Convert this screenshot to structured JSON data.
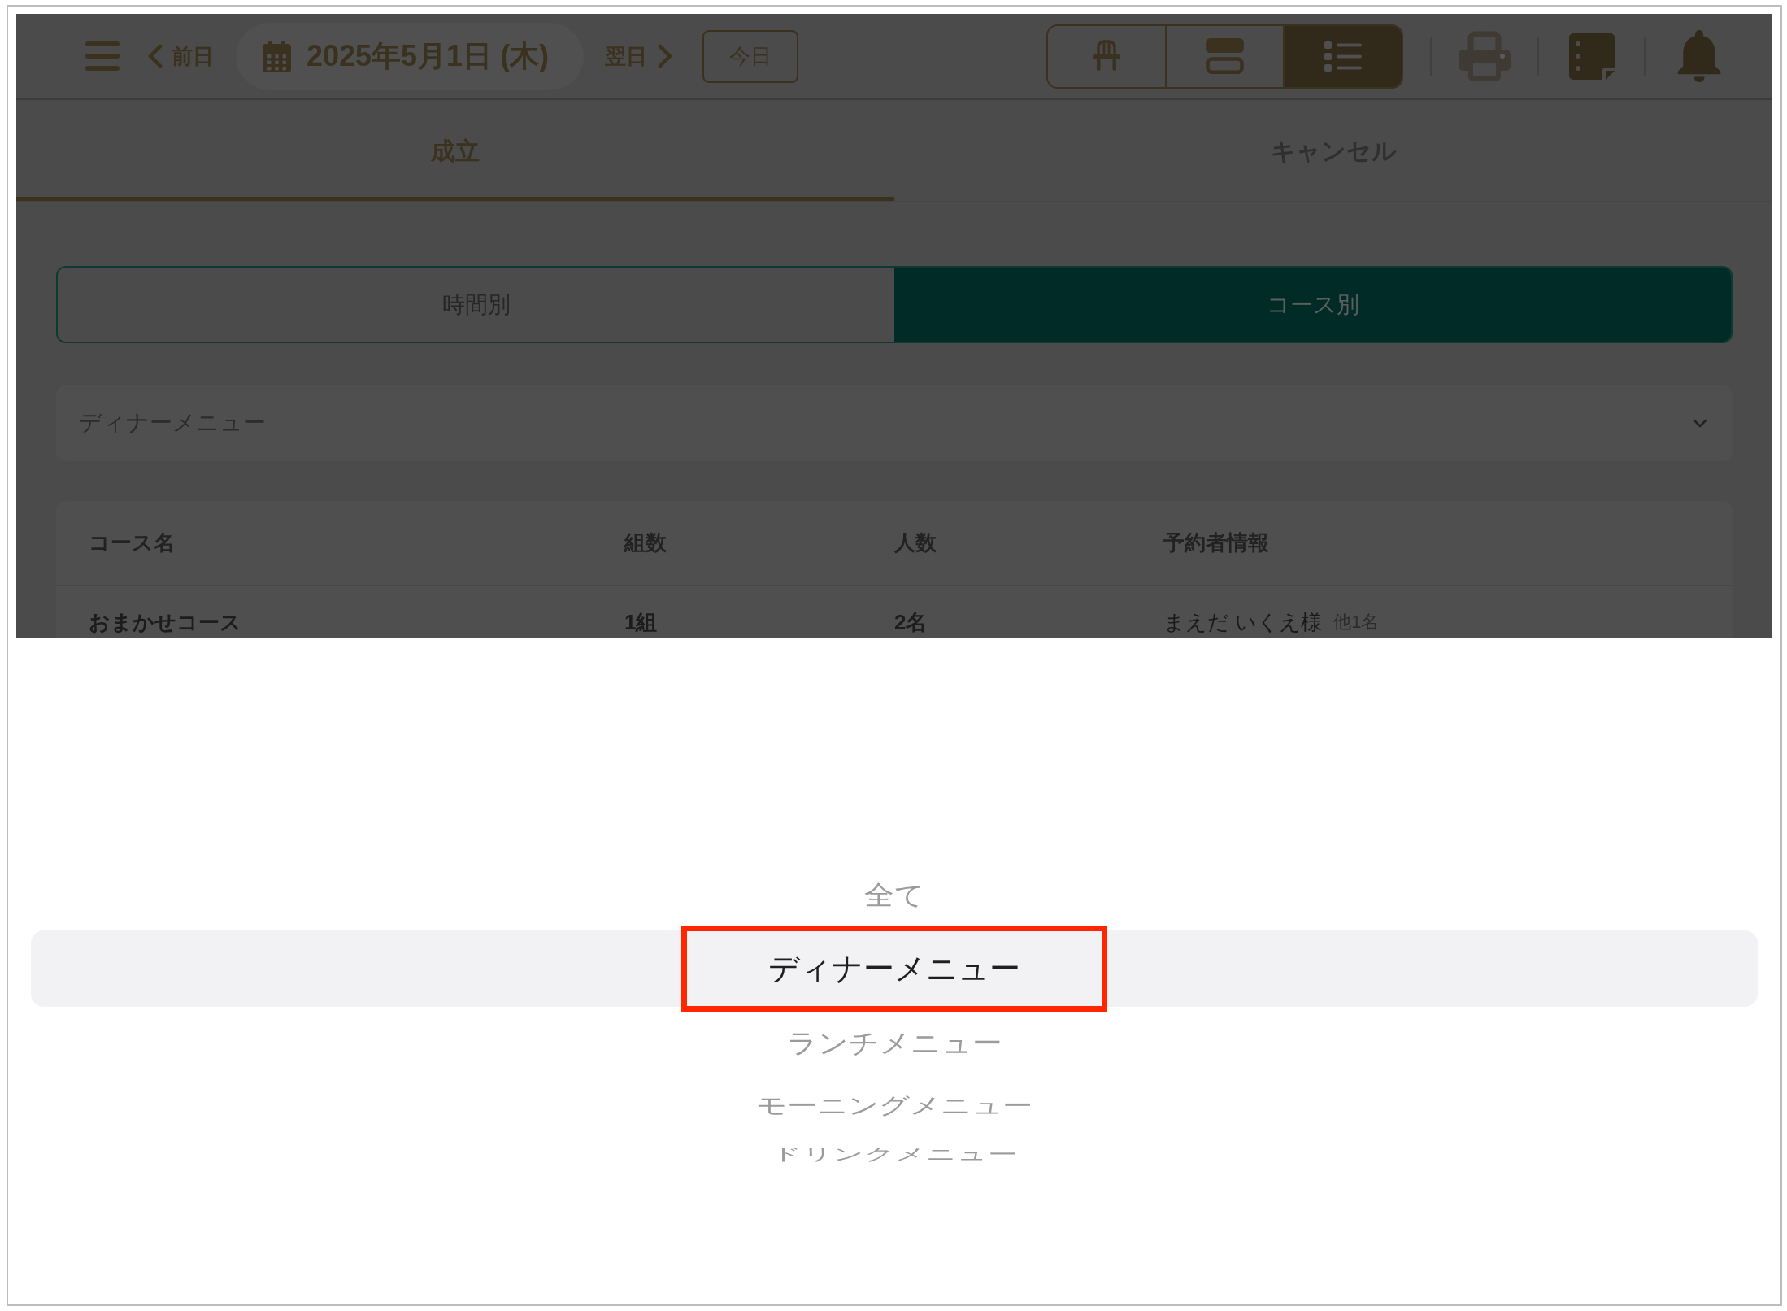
{
  "top_bar": {
    "prev_day": "前日",
    "date": "2025年5月1日 (木)",
    "next_day": "翌日",
    "today_button": "今日",
    "view_modes": [
      {
        "kind": "seat",
        "selected": false
      },
      {
        "kind": "rows",
        "selected": false
      },
      {
        "kind": "list",
        "selected": true
      }
    ],
    "actions": [
      {
        "kind": "printer",
        "disabled": true
      },
      {
        "kind": "note",
        "disabled": false
      },
      {
        "kind": "bell",
        "disabled": false
      }
    ]
  },
  "tabs": [
    {
      "label": "成立",
      "selected": true
    },
    {
      "label": "キャンセル",
      "selected": false
    }
  ],
  "segments": [
    {
      "label": "時間別",
      "selected": false
    },
    {
      "label": "コース別",
      "selected": true
    }
  ],
  "menu_select": {
    "value": "ディナーメニュー"
  },
  "table": {
    "columns": [
      "コース名",
      "組数",
      "人数",
      "予約者情報"
    ],
    "rows": [
      {
        "course": "おまかせコース",
        "groups": "1組",
        "guests": "2名",
        "booker": {
          "name": "まえだ いくえ様",
          "others": "他1名"
        }
      }
    ]
  },
  "picker": {
    "options": [
      {
        "label": "全て",
        "selected": false,
        "highlighted": false
      },
      {
        "label": "ディナーメニュー",
        "selected": true,
        "highlighted": true
      },
      {
        "label": "ランチメニュー",
        "selected": false,
        "highlighted": false
      },
      {
        "label": "モーニングメニュー",
        "selected": false,
        "highlighted": false
      },
      {
        "label": "ドリンクメニュー",
        "selected": false,
        "highlighted": false
      }
    ]
  }
}
